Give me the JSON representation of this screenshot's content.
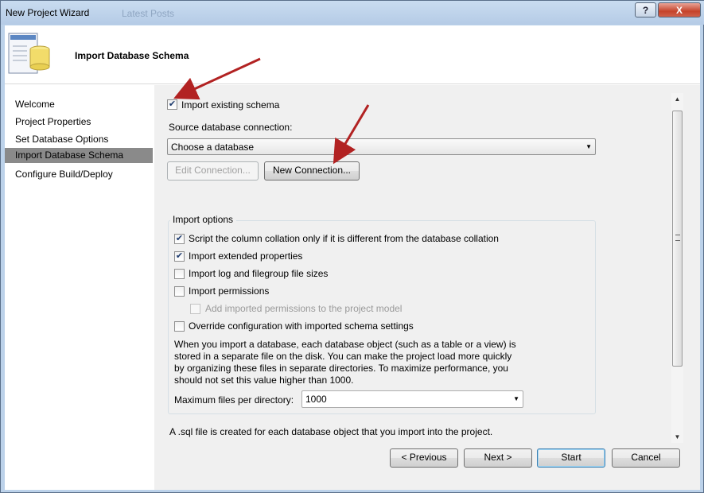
{
  "window": {
    "title": "New Project Wizard",
    "ghost_text": "Latest Posts",
    "help_label": "?",
    "close_label": "X"
  },
  "header": {
    "title": "Import Database Schema",
    "icon": "database-icon"
  },
  "nav": {
    "items": [
      {
        "label": "Welcome",
        "active": false
      },
      {
        "label": "Project Properties",
        "active": false
      },
      {
        "label": "Set Database Options",
        "active": false
      },
      {
        "label": "Import Database Schema",
        "active": true
      },
      {
        "label": "Configure Build/Deploy",
        "active": false
      }
    ]
  },
  "form": {
    "import_existing": {
      "label": "Import existing schema",
      "checked": true
    },
    "source_label": "Source database connection:",
    "source_select": {
      "value": "Choose a database"
    },
    "edit_connection_label": "Edit Connection...",
    "new_connection_label": "New Connection...",
    "import_options": {
      "title": "Import options",
      "script_collation": {
        "label": "Script the column collation only if it is different from the database collation",
        "checked": true
      },
      "extended_properties": {
        "label": "Import extended properties",
        "checked": true
      },
      "log_filegroup": {
        "label": "Import log and filegroup file sizes",
        "checked": false
      },
      "permissions": {
        "label": "Import permissions",
        "checked": false
      },
      "add_permissions": {
        "label": "Add imported permissions to the project model",
        "checked": false,
        "disabled": true
      },
      "override_config": {
        "label": "Override configuration with imported schema settings",
        "checked": false
      },
      "description": "When you import a database, each database object (such as a table or a view) is stored in a separate file on the disk. You can make the project load more quickly by organizing these files in separate directories. To maximize performance, you should not set this value higher than 1000.",
      "max_files_label": "Maximum files per directory:",
      "max_files_value": "1000"
    },
    "bottom_note": "A .sql file is created for each database object that you import into the project."
  },
  "buttons": {
    "previous": "< Previous",
    "next": "Next >",
    "start": "Start",
    "cancel": "Cancel"
  },
  "colors": {
    "annotation_arrow": "#b22222",
    "active_nav": "#8a8a8a",
    "pane_bg": "#f0f0f0"
  }
}
